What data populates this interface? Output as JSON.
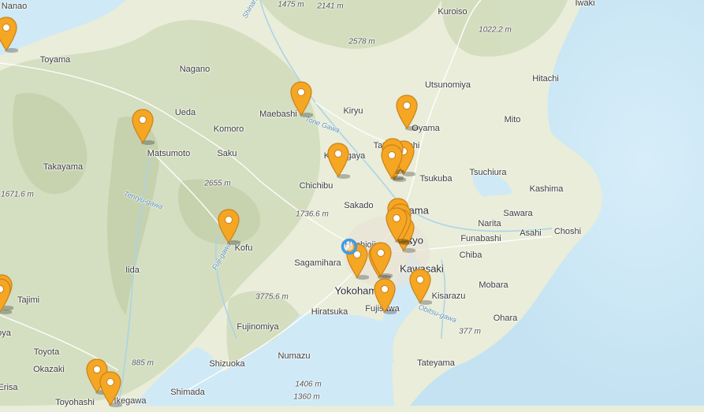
{
  "map": {
    "labels": [
      {
        "text": "Nanao",
        "kind": "place"
      },
      {
        "text": "Toyama",
        "kind": "place"
      },
      {
        "text": "Nagano",
        "kind": "place"
      },
      {
        "text": "Ueda",
        "kind": "place"
      },
      {
        "text": "Komoro",
        "kind": "place"
      },
      {
        "text": "Saku",
        "kind": "place"
      },
      {
        "text": "Maebashi",
        "kind": "place"
      },
      {
        "text": "Kiryu",
        "kind": "place"
      },
      {
        "text": "Matsumoto",
        "kind": "place"
      },
      {
        "text": "Takayama",
        "kind": "place"
      },
      {
        "text": "Chichibu",
        "kind": "place"
      },
      {
        "text": "Sakado",
        "kind": "place"
      },
      {
        "text": "Kofu",
        "kind": "place"
      },
      {
        "text": "Sagamihara",
        "kind": "place"
      },
      {
        "text": "Yokohama",
        "kind": "major"
      },
      {
        "text": "Kawasaki",
        "kind": "major"
      },
      {
        "text": "Saitama",
        "kind": "major"
      },
      {
        "text": "Tokyo",
        "kind": "major"
      },
      {
        "text": "Funabashi",
        "kind": "place"
      },
      {
        "text": "Chiba",
        "kind": "place"
      },
      {
        "text": "Narita",
        "kind": "place"
      },
      {
        "text": "Sawara",
        "kind": "place"
      },
      {
        "text": "Asahi",
        "kind": "place"
      },
      {
        "text": "Choshi",
        "kind": "place"
      },
      {
        "text": "Kashima",
        "kind": "place"
      },
      {
        "text": "Tsuchiura",
        "kind": "place"
      },
      {
        "text": "Tsukuba",
        "kind": "place"
      },
      {
        "text": "Mito",
        "kind": "place"
      },
      {
        "text": "Hitachi",
        "kind": "place"
      },
      {
        "text": "Utsunomiya",
        "kind": "place"
      },
      {
        "text": "Oyama",
        "kind": "place"
      },
      {
        "text": "Tatebayashi",
        "kind": "place"
      },
      {
        "text": "Kuroiso",
        "kind": "place"
      },
      {
        "text": "Iwaki",
        "kind": "place"
      },
      {
        "text": "Kumagaya",
        "kind": "place"
      },
      {
        "text": "Hachioji",
        "kind": "place"
      },
      {
        "text": "Hiratsuka",
        "kind": "place"
      },
      {
        "text": "Fujisawa",
        "kind": "place"
      },
      {
        "text": "Kisarazu",
        "kind": "place"
      },
      {
        "text": "Mobara",
        "kind": "place"
      },
      {
        "text": "Ohara",
        "kind": "place"
      },
      {
        "text": "Tateyama",
        "kind": "place"
      },
      {
        "text": "Fujinomiya",
        "kind": "place"
      },
      {
        "text": "Numazu",
        "kind": "place"
      },
      {
        "text": "Shizuoka",
        "kind": "place"
      },
      {
        "text": "Shimada",
        "kind": "place"
      },
      {
        "text": "Iida",
        "kind": "place"
      },
      {
        "text": "Tajimi",
        "kind": "place"
      },
      {
        "text": "Toyota",
        "kind": "place"
      },
      {
        "text": "Okazaki",
        "kind": "place"
      },
      {
        "text": "Ikegawa",
        "kind": "place"
      },
      {
        "text": "Toyohashi",
        "kind": "place"
      },
      {
        "text": "Erisa",
        "kind": "place"
      },
      {
        "text": "oya",
        "kind": "place"
      },
      {
        "text": "1475 m",
        "kind": "elev"
      },
      {
        "text": "2141 m",
        "kind": "elev"
      },
      {
        "text": "2578 m",
        "kind": "elev"
      },
      {
        "text": "1022.2 m",
        "kind": "elev"
      },
      {
        "text": "2655 m",
        "kind": "elev"
      },
      {
        "text": "1671.6 m",
        "kind": "elev"
      },
      {
        "text": "1736.6 m",
        "kind": "elev"
      },
      {
        "text": "3775.6 m",
        "kind": "elev"
      },
      {
        "text": "885 m",
        "kind": "elev"
      },
      {
        "text": "1406 m",
        "kind": "elev"
      },
      {
        "text": "1360 m",
        "kind": "elev"
      },
      {
        "text": "377 m",
        "kind": "elev"
      },
      {
        "text": "Tone Gawa",
        "kind": "water"
      },
      {
        "text": "Fuji-gawa",
        "kind": "water"
      },
      {
        "text": "Tenryu-gawa",
        "kind": "water"
      },
      {
        "text": "Shinano",
        "kind": "water"
      },
      {
        "text": "Obitsu-gawa",
        "kind": "water"
      }
    ],
    "pin_count": 24,
    "colors": {
      "land": "#e9edd9",
      "mountain": "#cfd9b8",
      "sea": "#cfe9f6",
      "pin": "#f5a623",
      "pin_stroke": "#c9821a",
      "location": "#3d9be9"
    }
  }
}
